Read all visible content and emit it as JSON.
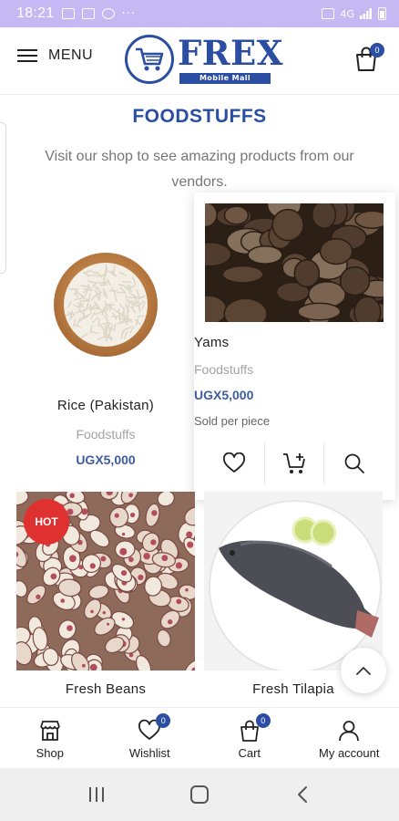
{
  "status_bar": {
    "time": "18:21",
    "dots": "···",
    "network": "4G"
  },
  "header": {
    "menu_label": "MENU",
    "logo_word": "FREX",
    "logo_tagline": "Mobile Mall",
    "cart_count": "0"
  },
  "page": {
    "title": "FOODSTUFFS",
    "subtitle": "Visit our shop to see amazing products from our vendors."
  },
  "products": [
    {
      "name": "Rice (Pakistan)",
      "category": "Foodstuffs",
      "price": "UGX5,000"
    },
    {
      "name": "Yams",
      "category": "Foodstuffs",
      "price": "UGX5,000",
      "note": "Sold per piece"
    },
    {
      "name": "Fresh Beans",
      "badge": "HOT"
    },
    {
      "name": "Fresh Tilapia"
    }
  ],
  "bottom_nav": {
    "items": [
      {
        "label": "Shop",
        "icon": "store-icon"
      },
      {
        "label": "Wishlist",
        "icon": "heart-icon",
        "count": "0"
      },
      {
        "label": "Cart",
        "icon": "cart-icon",
        "count": "0"
      },
      {
        "label": "My account",
        "icon": "user-icon"
      }
    ]
  },
  "colors": {
    "brand": "#2b4ea2",
    "price": "#3e5c9e",
    "hot": "#e03131",
    "status_bar": "#c6b8f2"
  }
}
